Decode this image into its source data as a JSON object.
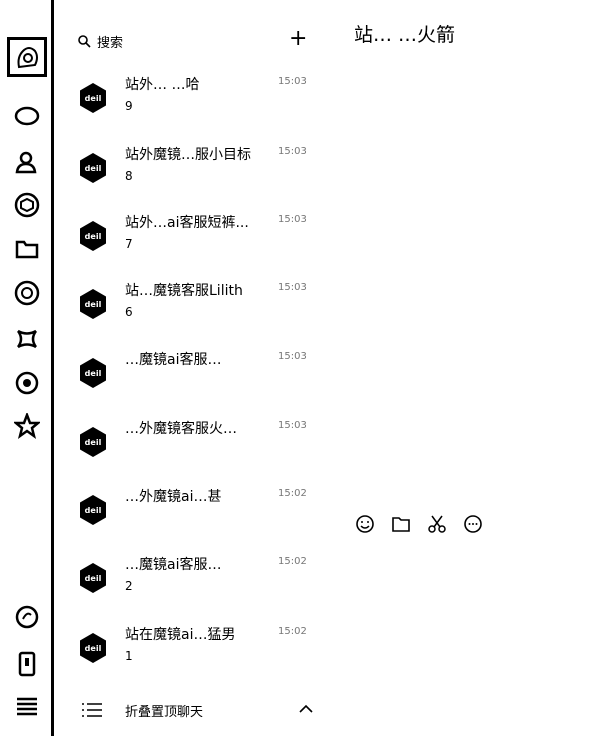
{
  "search": {
    "placeholder_label": "搜索"
  },
  "header": {
    "add_symbol": "+"
  },
  "chats": [
    {
      "name": "站外… …哈",
      "time": "15:03",
      "count": "9"
    },
    {
      "name": "站外魔镜…服小目标",
      "time": "15:03",
      "count": "8"
    },
    {
      "name": "站外…ai客服短裤...",
      "time": "15:03",
      "count": "7"
    },
    {
      "name": "站…魔镜客服Lilith",
      "time": "15:03",
      "count": "6"
    },
    {
      "name": "…魔镜ai客服…",
      "time": "15:03",
      "count": ""
    },
    {
      "name": "…外魔镜客服火…",
      "time": "15:03",
      "count": ""
    },
    {
      "name": "…外魔镜ai…甚",
      "time": "15:02",
      "count": ""
    },
    {
      "name": "…魔镜ai客服…",
      "time": "15:02",
      "count": "2"
    },
    {
      "name": "站在魔镜ai…猛男",
      "time": "15:02",
      "count": "1"
    }
  ],
  "fold": {
    "label": "折叠置顶聊天"
  },
  "conversation": {
    "title": "站… …火箭"
  },
  "icons": {
    "sidebar": [
      "avatar-icon",
      "chat-icon",
      "contacts-icon",
      "cube-icon",
      "folder-icon",
      "moments-icon",
      "mini-program-icon",
      "settings-icon",
      "star-icon",
      "bottom-circle-icon",
      "phone-icon",
      "menu-icon"
    ],
    "toolbar": [
      "emoji-icon",
      "folder-icon",
      "scissors-icon",
      "chat-bubble-icon"
    ]
  }
}
